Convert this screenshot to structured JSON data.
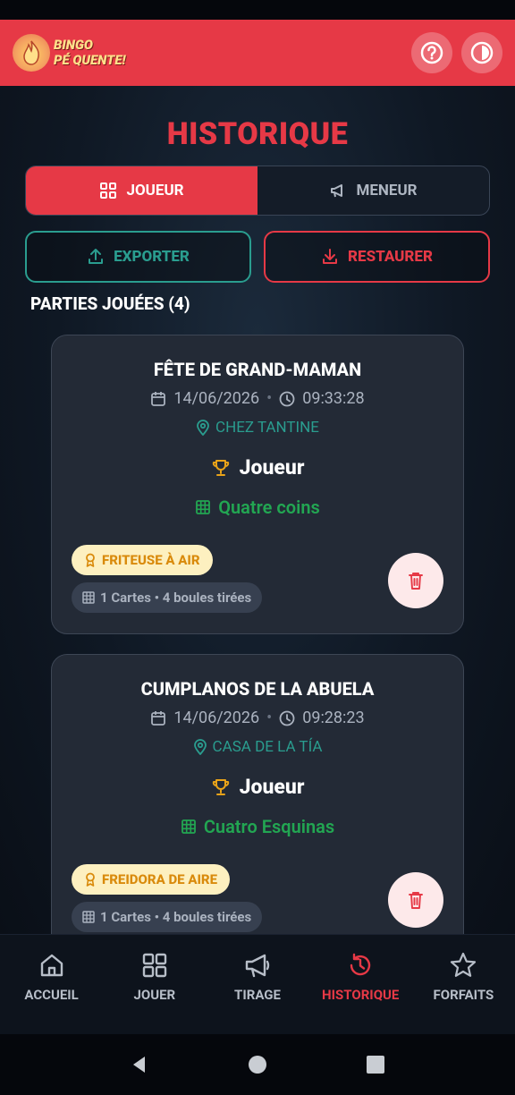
{
  "app": {
    "logo_line1": "BINGO",
    "logo_line2": "PÉ QUENTE!"
  },
  "header": {
    "help_icon": "question-icon",
    "theme_icon": "theme-toggle-icon",
    "accent": "#e63946"
  },
  "page": {
    "title": "HISTORIQUE"
  },
  "toggle": {
    "player_label": "JOUEUR",
    "host_label": "MENEUR",
    "active": "player"
  },
  "actions": {
    "export_label": "EXPORTER",
    "restore_label": "RESTAURER"
  },
  "section": {
    "title": "PARTIES JOUÉES (4)"
  },
  "games": [
    {
      "name": "FÊTE DE GRAND-MAMAN",
      "date": "14/06/2026",
      "time": "09:33:28",
      "place": "CHEZ TANTINE",
      "role": "Joueur",
      "pattern": "Quatre coins",
      "prize": "FRITEUSE À AIR",
      "stats": "1 Cartes • 4 boules tirées"
    },
    {
      "name": "CUMPLANOS DE LA ABUELA",
      "date": "14/06/2026",
      "time": "09:28:23",
      "place": "CASA DE LA TÍA",
      "role": "Joueur",
      "pattern": "Cuatro Esquinas",
      "prize": "FREIDORA DE AIRE",
      "stats": "1 Cartes • 4 boules tirées"
    }
  ],
  "nav": {
    "items": [
      {
        "label": "ACCUEIL",
        "icon": "home-icon"
      },
      {
        "label": "JOUER",
        "icon": "grid-icon"
      },
      {
        "label": "TIRAGE",
        "icon": "megaphone-icon"
      },
      {
        "label": "HISTORIQUE",
        "icon": "history-icon",
        "active": true
      },
      {
        "label": "FORFAITS",
        "icon": "star-icon"
      }
    ]
  }
}
